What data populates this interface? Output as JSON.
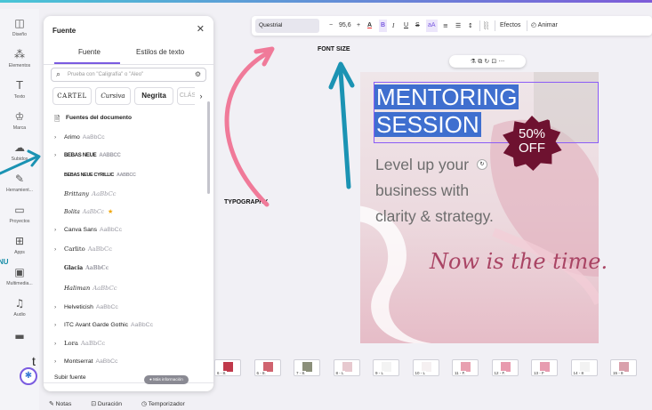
{
  "rail": {
    "items": [
      {
        "label": "Diseño",
        "icon": "layout-icon",
        "glyph": "◫"
      },
      {
        "label": "Elementos",
        "icon": "elements-icon",
        "glyph": "⁂"
      },
      {
        "label": "Texto",
        "icon": "text-icon",
        "glyph": "T"
      },
      {
        "label": "Marca",
        "icon": "brand-icon",
        "glyph": "♔"
      },
      {
        "label": "Subidos",
        "icon": "upload-icon",
        "glyph": "☁"
      },
      {
        "label": "Herramient...",
        "icon": "draw-icon",
        "glyph": "✎"
      },
      {
        "label": "Proyectos",
        "icon": "folder-icon",
        "glyph": "▭"
      },
      {
        "label": "Apps",
        "icon": "apps-icon",
        "glyph": "⊞"
      },
      {
        "label": "Multimedia...",
        "icon": "media-icon",
        "glyph": "▣"
      },
      {
        "label": "Audio",
        "icon": "audio-icon",
        "glyph": "♫"
      },
      {
        "label": "",
        "icon": "more-icon",
        "glyph": "▬"
      }
    ]
  },
  "panel": {
    "title": "Fuente",
    "tabs": [
      "Fuente",
      "Estilos de texto"
    ],
    "search_placeholder": "Prueba con \"Caligrafía\" o \"Aleo\"",
    "chips": [
      "CARTEL",
      "Cursiva",
      "Negrita",
      "CLÁS"
    ],
    "section_title": "Fuentes del documento",
    "fonts": [
      {
        "name": "Arimo",
        "sample": "AaBbCc",
        "expandable": true,
        "star": false
      },
      {
        "name": "BEBAS NEUE",
        "sample": "AABBCC",
        "expandable": true,
        "star": false
      },
      {
        "name": "BEBAS NEUE CYRILLIC",
        "sample": "AABBCC",
        "expandable": false,
        "star": false
      },
      {
        "name": "Brittany",
        "sample": "AaBbCc",
        "expandable": false,
        "star": false
      },
      {
        "name": "Bolita",
        "sample": "AaBbCc",
        "expandable": false,
        "star": true
      },
      {
        "name": "Canva Sans",
        "sample": "AaBbCc",
        "expandable": true,
        "star": false
      },
      {
        "name": "Carlito",
        "sample": "AaBbCc",
        "expandable": true,
        "star": false
      },
      {
        "name": "Glacia",
        "sample": "AaBbCc",
        "expandable": false,
        "star": false
      },
      {
        "name": "Haliman",
        "sample": "AaBbCc",
        "expandable": false,
        "star": false
      },
      {
        "name": "Helveticish",
        "sample": "AaBbCc",
        "expandable": true,
        "star": false
      },
      {
        "name": "ITC Avant Garde Gothic",
        "sample": "AaBbCc",
        "expandable": true,
        "star": false
      },
      {
        "name": "Lora",
        "sample": "AaBbCc",
        "expandable": true,
        "star": false
      },
      {
        "name": "Montserrat",
        "sample": "AaBbCc",
        "expandable": true,
        "star": false
      }
    ],
    "upload_label": "Subir fuente",
    "more_info": "Más información"
  },
  "toolbar": {
    "font": "Questrial",
    "minus": "−",
    "size": "95,6",
    "plus": "+",
    "text_color": "A",
    "bold": "B",
    "italic": "I",
    "underline": "U",
    "strike": "S",
    "case": "aA",
    "align": "≡",
    "list": "☰",
    "spacing": "↕",
    "transparency": "░",
    "effects": "Efectos",
    "animate": "Animar"
  },
  "annotations": {
    "font_size": "FONT SIZE",
    "typography": "TYPOGRAPHY",
    "menu_fragment": "NU",
    "t_fragment": "t"
  },
  "mini_toolbar": "⚗ ⧉ ↻ ⊡ ···",
  "design": {
    "title_lines": [
      "MENTORING",
      "SESSION"
    ],
    "badge": [
      "50%",
      "OFF"
    ],
    "body_lines": [
      "Level up your",
      "business with",
      "clarity & strategy."
    ],
    "script": "Now is the time."
  },
  "thumbnails": [
    "6 - 8.",
    "6 - 8.",
    "7 - 8.",
    "8 - L",
    "9 - L",
    "10 - L",
    "11 - F.",
    "12 - F.",
    "13 - F",
    "14 - 8",
    "15 - 8"
  ],
  "footer": {
    "notes": "Notas",
    "duration": "Duración",
    "timer": "Temporizador"
  },
  "colors": {
    "accent": "#7a5be0",
    "selection": "#3f6fcf",
    "badge": "#6e1230",
    "arrow_pink": "#f07a99",
    "arrow_teal": "#1b93b3"
  }
}
